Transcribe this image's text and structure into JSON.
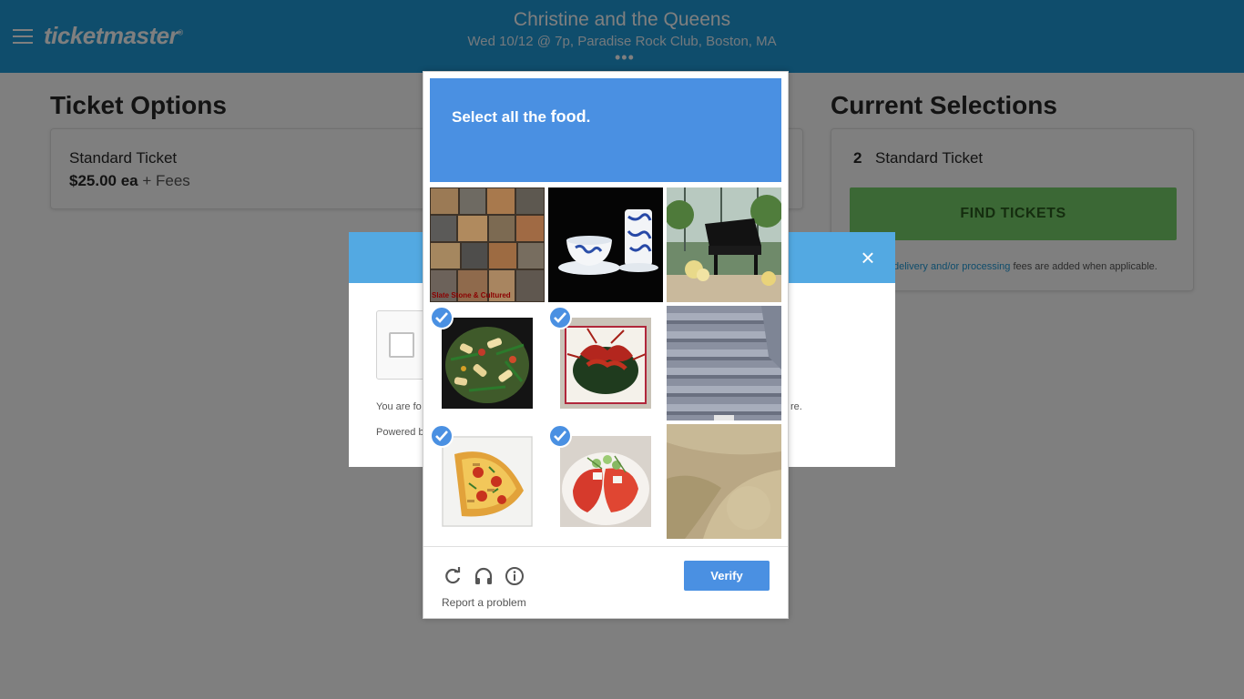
{
  "header": {
    "logo": "ticketmaster",
    "logo_mark": "®",
    "event_title": "Christine and the Queens",
    "event_subtitle": "Wed 10/12 @ 7p, Paradise Rock Club, Boston, MA",
    "more": "•••"
  },
  "ticket_options": {
    "title": "Ticket Options",
    "ticket_name": "Standard Ticket",
    "price": "$25.00 ea",
    "price_suffix": " + Fees"
  },
  "current_selections": {
    "title": "Current Selections",
    "quantity": "2",
    "ticket_name": "Standard Ticket",
    "find_button": "FIND TICKETS",
    "fees_link": "delivery and/or processing",
    "fees_rest": " fees are added when applicable."
  },
  "modal": {
    "close": "×",
    "text_line1": "You are fo",
    "text_line1_tail": "re.",
    "text_line2": "Powered b"
  },
  "captcha": {
    "instruction_prefix": "Select all the ",
    "instruction_target": "food",
    "instruction_suffix": ".",
    "tiles": [
      {
        "subject": "slate tiles",
        "selected": false,
        "caption": "Slate Stone & Cultured"
      },
      {
        "subject": "teacup and vase",
        "selected": false
      },
      {
        "subject": "piano",
        "selected": false
      },
      {
        "subject": "stir fry",
        "selected": true
      },
      {
        "subject": "crawfish",
        "selected": true
      },
      {
        "subject": "stairs",
        "selected": false
      },
      {
        "subject": "pizza",
        "selected": true
      },
      {
        "subject": "tomato salad",
        "selected": true
      },
      {
        "subject": "floor",
        "selected": false
      }
    ],
    "reload_icon": "reload-icon",
    "audio_icon": "headphones-icon",
    "info_icon": "info-icon",
    "report": "Report a problem",
    "verify": "Verify"
  },
  "colors": {
    "header": "#1f9ad8",
    "captcha_accent": "#4a90e2",
    "find_button": "#76d06b"
  }
}
